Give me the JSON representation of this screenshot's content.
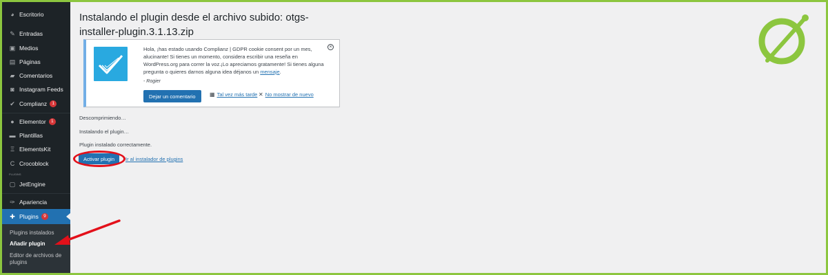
{
  "sidebar": {
    "items": [
      {
        "label": "Escritorio",
        "icon": "dashboard-icon"
      },
      {
        "label": "Entradas",
        "icon": "pin-icon"
      },
      {
        "label": "Medios",
        "icon": "media-icon"
      },
      {
        "label": "Páginas",
        "icon": "pages-icon"
      },
      {
        "label": "Comentarios",
        "icon": "comments-icon"
      },
      {
        "label": "Instagram Feeds",
        "icon": "instagram-icon"
      },
      {
        "label": "Complianz",
        "icon": "check-icon",
        "badge": "1"
      },
      {
        "label": "Elementor",
        "icon": "elementor-icon",
        "badge": "1"
      },
      {
        "label": "Plantillas",
        "icon": "folder-icon"
      },
      {
        "label": "ElementsKit",
        "icon": "elementskit-icon"
      },
      {
        "label": "Crocoblock",
        "icon": "crocoblock-icon"
      },
      {
        "label": "JetEngine",
        "icon": "jetengine-icon"
      },
      {
        "label": "Apariencia",
        "icon": "brush-icon"
      },
      {
        "label": "Plugins",
        "icon": "plug-icon",
        "badge": "9"
      }
    ],
    "section_label": "PLUGINS",
    "submenu": [
      {
        "label": "Plugins instalados"
      },
      {
        "label": "Añadir plugin"
      },
      {
        "label": "Editor de archivos de plugins"
      }
    ]
  },
  "main": {
    "title": "Instalando el plugin desde el archivo subido: otgs-installer-plugin.3.1.13.zip",
    "notice": {
      "text": "Hola, ¡has estado usando Complianz | GDPR cookie consent por un mes, alucinante! Si tienes un momento, considera escribir una reseña en WordPress.org para correr la voz.¡Lo apreciamos gratamente! Si tienes alguna pregunta o quieres darnos alguna idea déjanos un",
      "link": "mensaje",
      "link_suffix": ".",
      "signature": "- Rogier",
      "button": "Dejar un comentario",
      "later": "Tal vez más tarde",
      "never": "No mostrar de nuevo"
    },
    "log": [
      "Descomprimiendo…",
      "Instalando el plugin…",
      "Plugin instalado correctamente."
    ],
    "activate_button": "Activar plugin",
    "installer_link": "Ir al instalador de plugins"
  },
  "colors": {
    "frame": "#8cc63f",
    "sidebar": "#1d2327",
    "accent": "#2271b1",
    "highlight": "#e3101a",
    "logo_green": "#8cc63f"
  }
}
